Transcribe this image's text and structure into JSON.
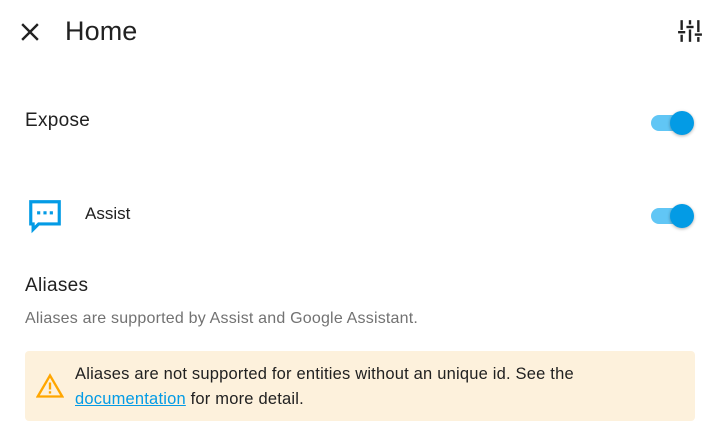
{
  "header": {
    "title": "Home",
    "close_icon": "close-icon",
    "settings_icon": "tune-sliders-icon"
  },
  "expose": {
    "label": "Expose",
    "enabled": true
  },
  "assist": {
    "label": "Assist",
    "icon": "message-processing-icon",
    "enabled": true
  },
  "aliases": {
    "title": "Aliases",
    "description": "Aliases are supported by Assist and Google Assistant."
  },
  "warning": {
    "icon": "alert-triangle-icon",
    "text_before": "Aliases are not supported for entities without an unique id. See the",
    "link_text": "documentation",
    "text_after": "for more detail."
  },
  "colors": {
    "accent": "#039be5",
    "toggle_track": "#61c6f5",
    "warning_bg": "#fdf1dc",
    "warning_icon": "#ffa600"
  }
}
